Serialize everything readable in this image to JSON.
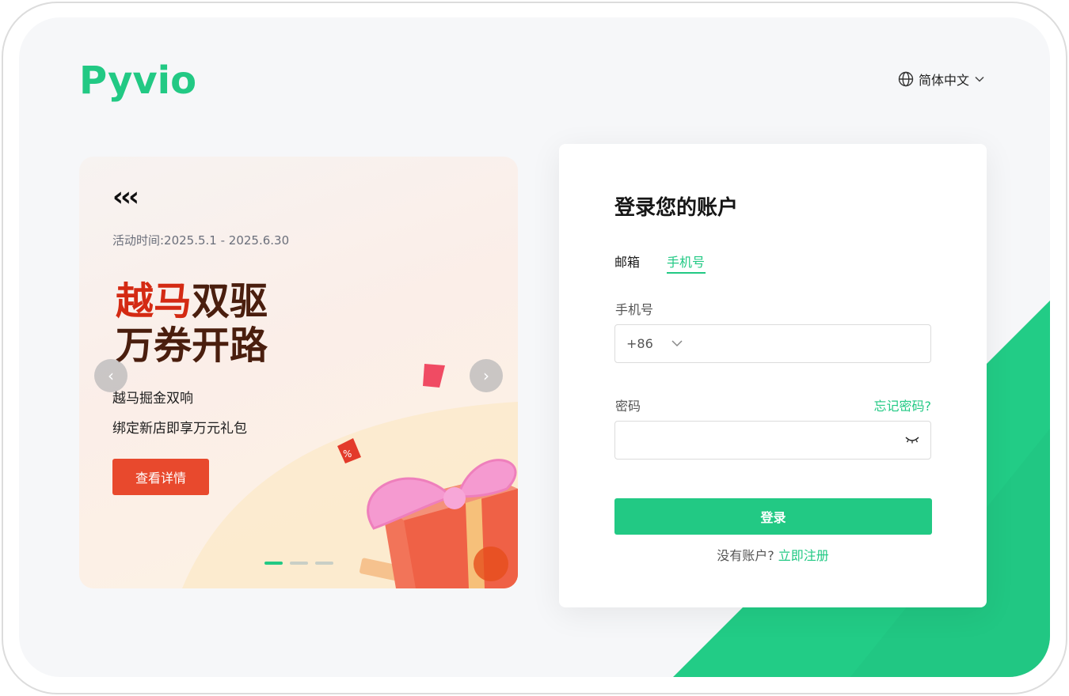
{
  "brand": {
    "logo_text": "Pyvio",
    "color": "#22c984"
  },
  "language": {
    "label": "简体中文",
    "icon": "globe-icon"
  },
  "banner": {
    "quote_mark": "‹‹‹",
    "period": "活动时间:2025.5.1 - 2025.6.30",
    "headline_red": "越马",
    "headline_line1_rest": "双驱",
    "headline_line2": "万券开路",
    "subline1": "越马掘金双响",
    "subline2": "绑定新店即享万元礼包",
    "detail_button": "查看详情",
    "prev_arrow": "‹",
    "next_arrow": "›",
    "slides_total": 3,
    "slide_active": 1
  },
  "login": {
    "title": "登录您的账户",
    "tabs": [
      {
        "label": "邮箱",
        "active": false
      },
      {
        "label": "手机号",
        "active": true
      }
    ],
    "phone_label": "手机号",
    "country_code": "+86",
    "phone_value": "",
    "password_label": "密码",
    "forgot_label": "忘记密码?",
    "password_value": "",
    "submit_label": "登录",
    "no_account_text": "没有账户?",
    "signup_label": "立即注册"
  },
  "colors": {
    "accent": "#22c984",
    "cta_red": "#e8492d",
    "headline_brown": "#4a1e0e",
    "headline_red": "#d42a13"
  }
}
